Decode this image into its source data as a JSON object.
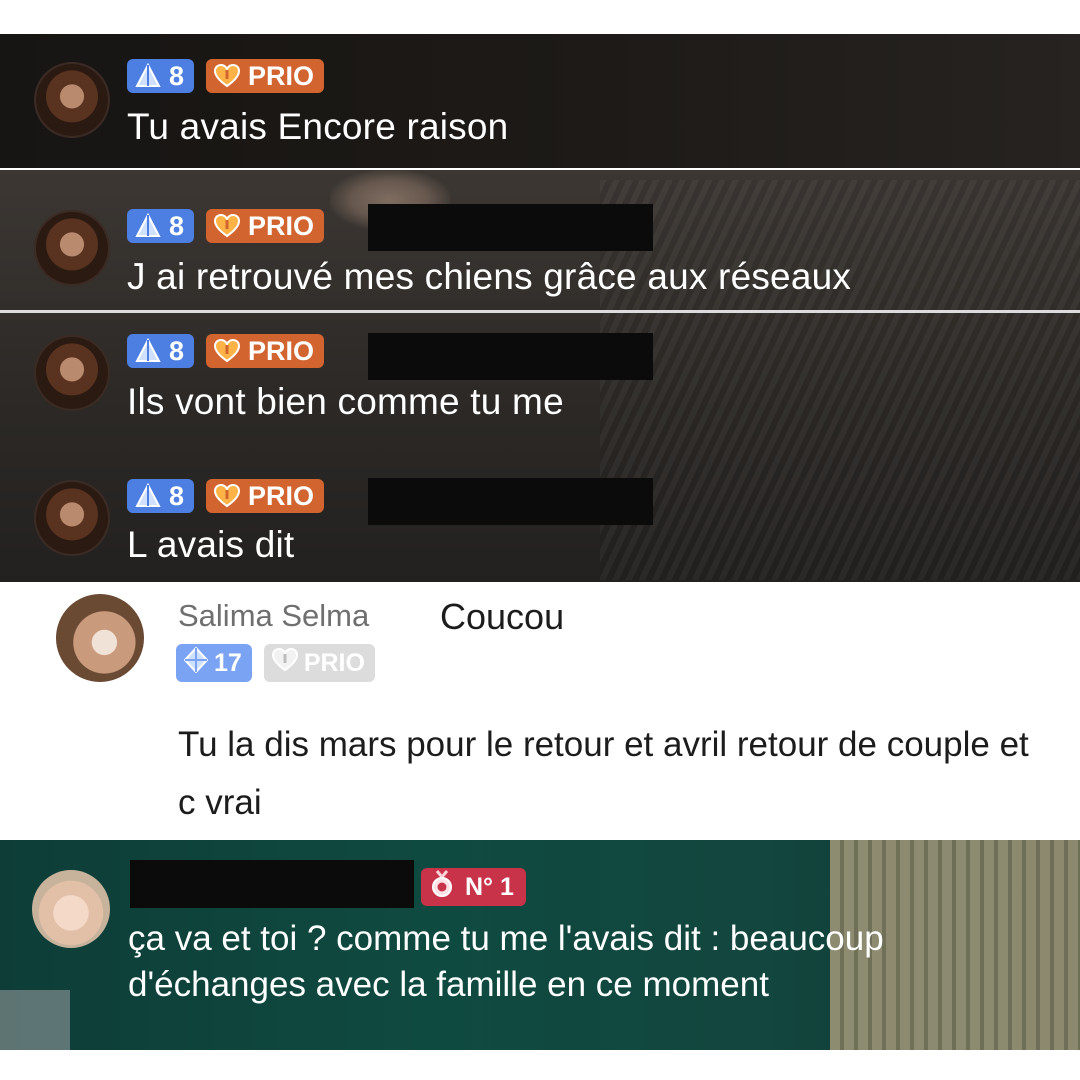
{
  "chat_messages": [
    {
      "level": "8",
      "prio_label": "PRIO",
      "text": "Tu avais Encore raison"
    },
    {
      "level": "8",
      "prio_label": "PRIO",
      "text": "J ai retrouvé mes chiens grâce aux réseaux"
    },
    {
      "level": "8",
      "prio_label": "PRIO",
      "text": "Ils vont bien comme tu me"
    },
    {
      "level": "8",
      "prio_label": "PRIO",
      "text": "L avais dit"
    }
  ],
  "comment": {
    "username": "Salima Selma",
    "first_message": "Coucou",
    "level": "17",
    "prio_label": "PRIO",
    "body": "Tu la dis mars pour le retour et avril retour de couple et c vrai"
  },
  "last_message": {
    "rank_label": "N° 1",
    "text": "ça va et toi ? comme tu me l'avais dit : beaucoup d'échanges avec la famille en ce moment"
  },
  "colors": {
    "level_badge": "#4d7fe3",
    "prio_badge": "#d1642f",
    "rank_badge": "#c8334a",
    "muted_level_badge": "#7ba3f4",
    "muted_prio_badge": "#dcdcdc"
  },
  "icons": {
    "level": "pyramid-icon",
    "prio": "heart-icon",
    "rank": "medal-icon"
  }
}
